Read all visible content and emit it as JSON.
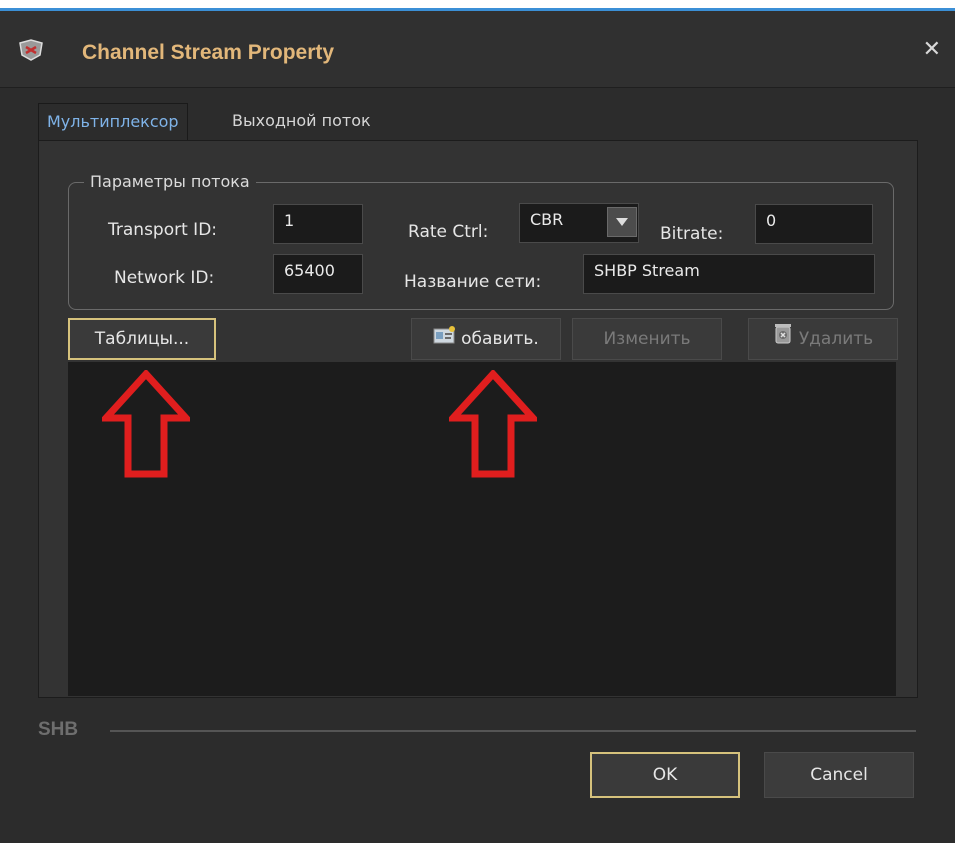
{
  "window": {
    "title": "Channel Stream Property",
    "close_glyph": "✕",
    "accent_color": "#3b8fd6",
    "title_color": "#e2b77a"
  },
  "tabs": [
    {
      "label": "Мультиплексор",
      "active": true
    },
    {
      "label": "Выходной поток",
      "active": false
    }
  ],
  "stream_params": {
    "group_title": "Параметры потока",
    "transport_id_label": "Transport ID:",
    "transport_id_value": "1",
    "network_id_label": "Network ID:",
    "network_id_value": "65400",
    "rate_ctrl_label": "Rate Ctrl:",
    "rate_ctrl_value": "CBR",
    "bitrate_label": "Bitrate:",
    "bitrate_value": "0",
    "network_name_label": "Название сети:",
    "network_name_value": "SHBP Stream"
  },
  "toolbar": {
    "tables_label": "Таблицы...",
    "add_label": "обавить.",
    "edit_label": "Изменить",
    "delete_label": "Удалить"
  },
  "annotation": {
    "arrow_color": "#e01e1e"
  },
  "status": {
    "label": "SHB"
  },
  "footer": {
    "ok_label": "OK",
    "cancel_label": "Cancel"
  }
}
